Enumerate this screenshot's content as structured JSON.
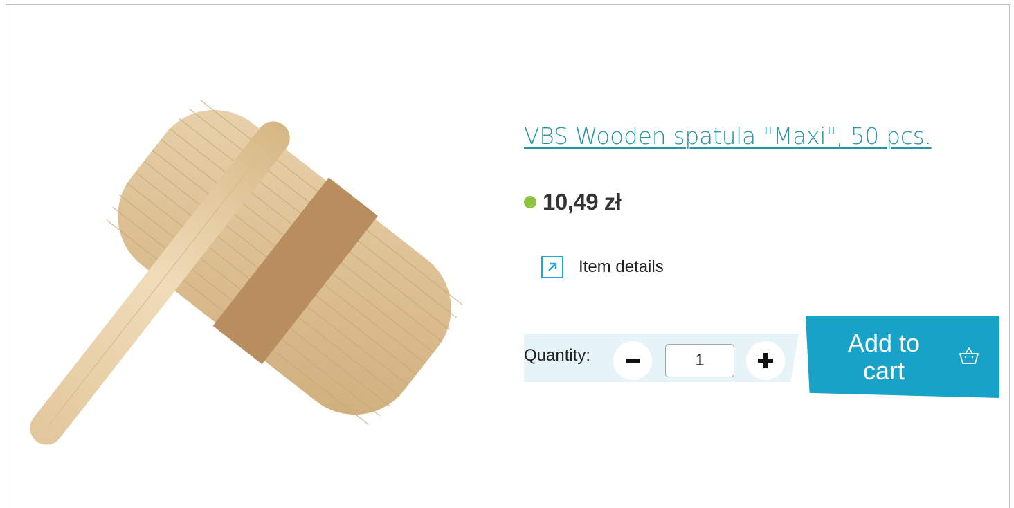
{
  "product": {
    "title": "VBS Wooden spatula \"Maxi\", 50 pcs.",
    "price": "10,49 zł",
    "stock_color": "#8cc43f",
    "details_label": "Item details",
    "details_icon": "external-arrow-icon"
  },
  "cart": {
    "quantity_label": "Quantity:",
    "quantity_value": "1",
    "minus_icon": "minus-icon",
    "plus_icon": "plus-icon",
    "add_label": "Add to cart",
    "cart_icon": "basket-icon",
    "accent_color": "#19a2c7"
  }
}
